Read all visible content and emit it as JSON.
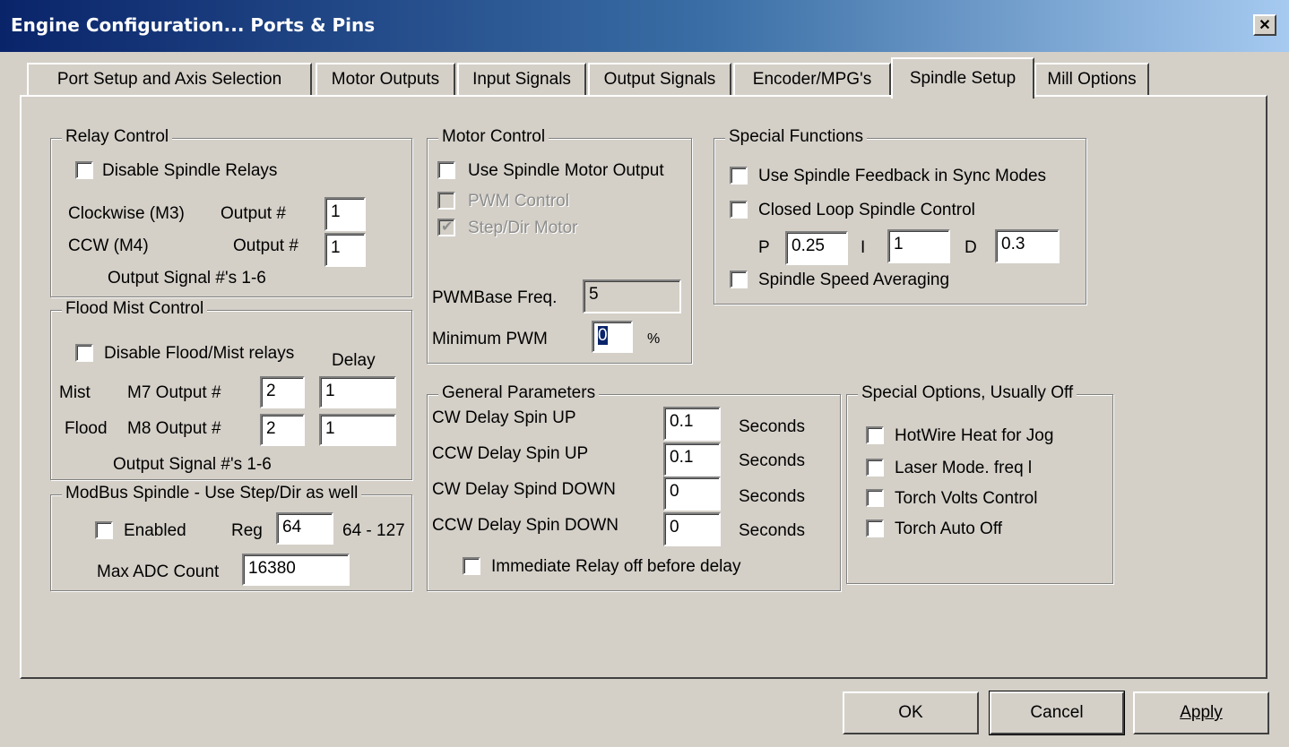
{
  "window": {
    "title": "Engine Configuration... Ports & Pins",
    "close_glyph": "✕"
  },
  "tabs": [
    "Port Setup and Axis Selection",
    "Motor Outputs",
    "Input Signals",
    "Output Signals",
    "Encoder/MPG's",
    "Spindle Setup",
    "Mill Options"
  ],
  "active_tab": "Spindle Setup",
  "relay_control": {
    "title": "Relay Control",
    "disable_label": "Disable Spindle Relays",
    "disable_checked": false,
    "cw_label": "Clockwise (M3)",
    "ccw_label": "CCW (M4)",
    "output_label": "Output #",
    "cw_output": "1",
    "ccw_output": "1",
    "note": "Output Signal #'s 1-6"
  },
  "flood_mist": {
    "title": "Flood Mist Control",
    "disable_label": "Disable Flood/Mist relays",
    "disable_checked": false,
    "delay_label": "Delay",
    "mist_label": "Mist",
    "m7_label": "M7 Output #",
    "mist_output": "2",
    "mist_delay": "1",
    "flood_label": "Flood",
    "m8_label": "M8 Output #",
    "flood_output": "2",
    "flood_delay": "1",
    "note": "Output Signal #'s 1-6"
  },
  "modbus": {
    "title": "ModBus Spindle - Use Step/Dir as well",
    "enabled_label": "Enabled",
    "enabled_checked": false,
    "reg_label": "Reg",
    "reg_value": "64",
    "reg_range": "64 - 127",
    "max_adc_label": "Max ADC Count",
    "max_adc_value": "16380"
  },
  "motor_control": {
    "title": "Motor Control",
    "use_motor_label": "Use Spindle Motor Output",
    "use_motor_checked": false,
    "pwm_label": "PWM Control",
    "pwm_checked": false,
    "stepdir_label": "Step/Dir Motor",
    "stepdir_checked": true,
    "check_glyph": "✔",
    "pwm_base_label": "PWMBase Freq.",
    "pwm_base_value": "5",
    "min_pwm_label": "Minimum PWM",
    "min_pwm_value": "0",
    "min_pwm_unit": "%"
  },
  "special_functions": {
    "title": "Special Functions",
    "feedback_label": "Use Spindle Feedback in Sync Modes",
    "feedback_checked": false,
    "closed_loop_label": "Closed Loop Spindle Control",
    "closed_loop_checked": false,
    "p_label": "P",
    "p_value": "0.25",
    "i_label": "I",
    "i_value": "1",
    "d_label": "D",
    "d_value": "0.3",
    "averaging_label": "Spindle Speed Averaging",
    "averaging_checked": false
  },
  "general_params": {
    "title": "General Parameters",
    "seconds_label": "Seconds",
    "rows": [
      {
        "label": "CW Delay Spin UP",
        "value": "0.1"
      },
      {
        "label": "CCW Delay Spin UP",
        "value": "0.1"
      },
      {
        "label": "CW Delay Spind DOWN",
        "value": "0"
      },
      {
        "label": "CCW Delay Spin DOWN",
        "value": "0"
      }
    ],
    "immediate_label": "Immediate Relay off before delay",
    "immediate_checked": false
  },
  "special_options": {
    "title": "Special Options, Usually Off",
    "items": [
      "HotWire Heat for Jog",
      "Laser Mode. freq l",
      "Torch Volts Control",
      "Torch Auto Off"
    ]
  },
  "buttons": {
    "ok": "OK",
    "cancel": "Cancel",
    "apply": "Apply"
  }
}
